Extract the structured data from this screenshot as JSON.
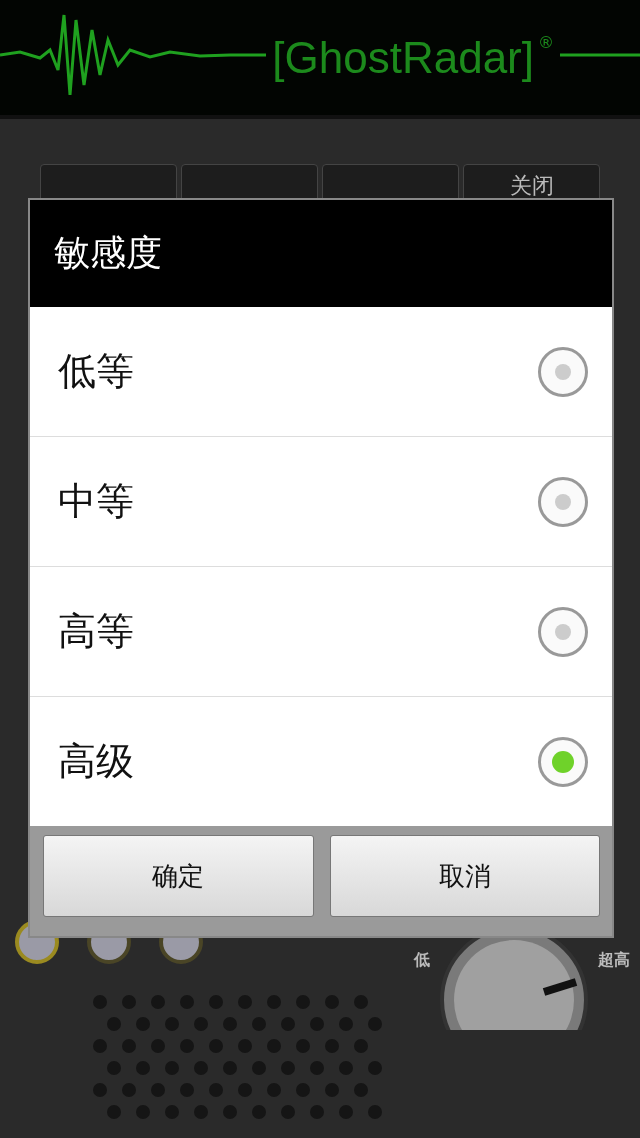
{
  "app_header": {
    "logo": "[GhostRadar]",
    "registered_mark": "®"
  },
  "tabs": [
    {
      "selected": false
    },
    {
      "selected": false
    },
    {
      "selected": false
    },
    {
      "label": "关闭",
      "selected": false
    }
  ],
  "dialog": {
    "title": "敏感度",
    "options": [
      {
        "label": "低等",
        "selected": false
      },
      {
        "label": "中等",
        "selected": false
      },
      {
        "label": "高等",
        "selected": false
      },
      {
        "label": "高级",
        "selected": true
      }
    ],
    "buttons": [
      "确定",
      "取消"
    ]
  },
  "knob": {
    "min_label": "低",
    "max_label": "超高"
  }
}
